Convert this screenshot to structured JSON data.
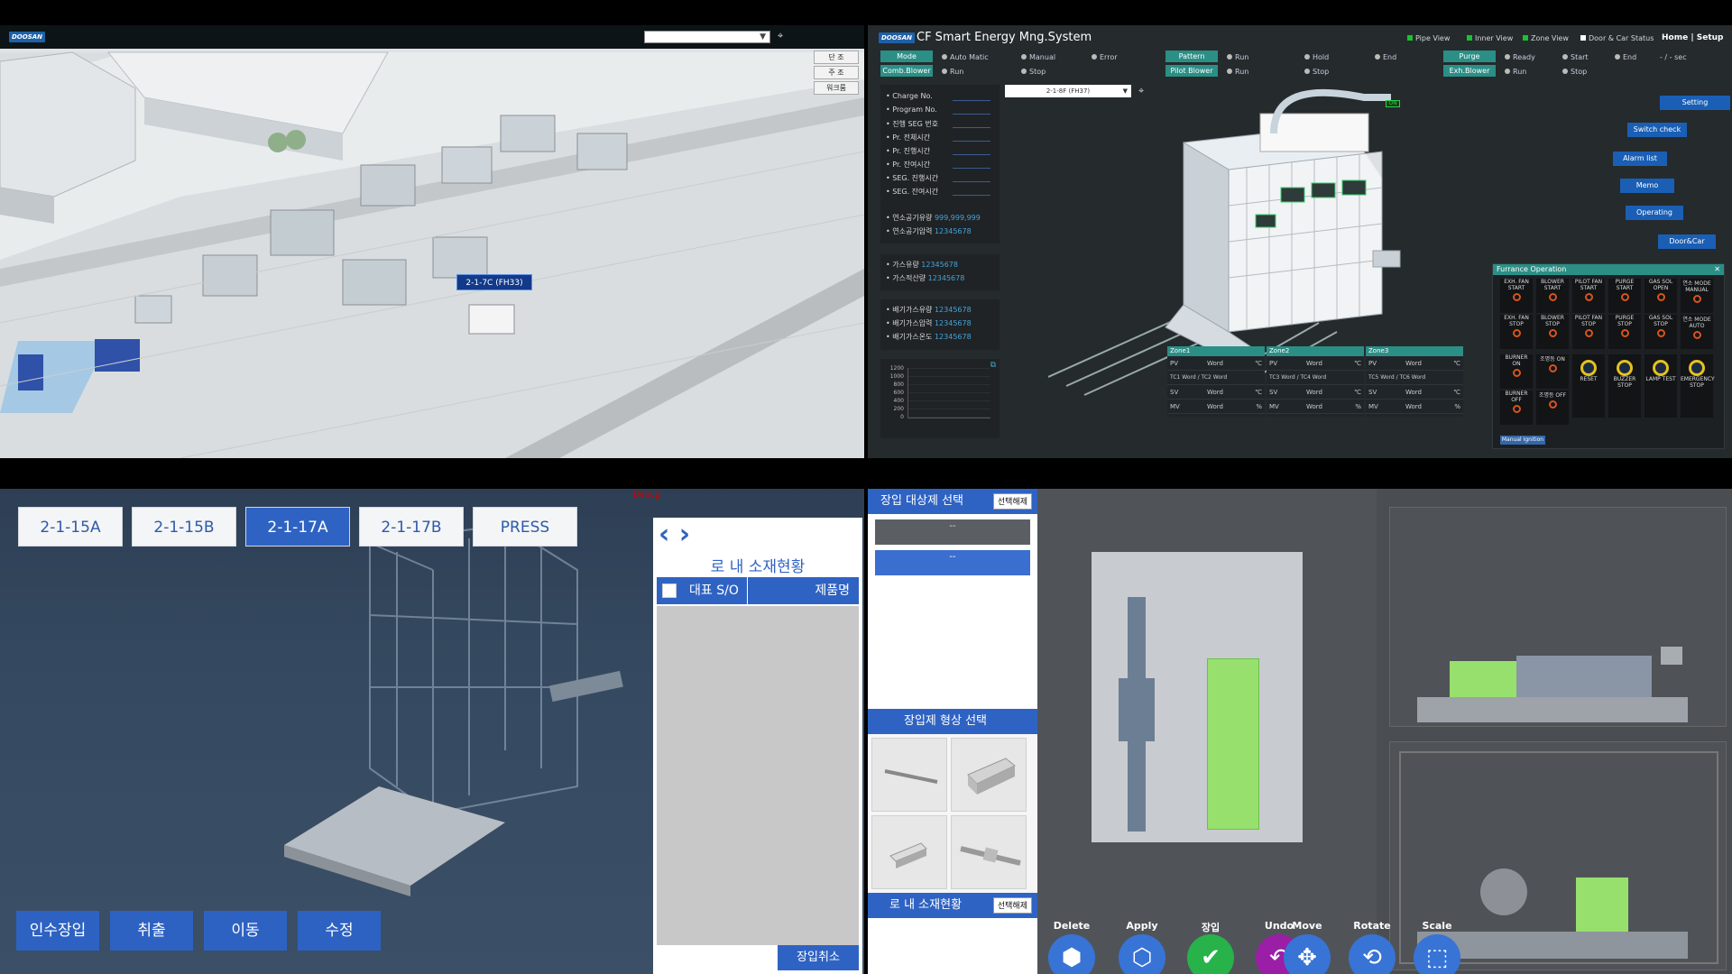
{
  "panel1": {
    "logo": "DOOSAN",
    "buttons": [
      "단 조",
      "주 조",
      "워크룸"
    ],
    "highlight_label": "2-1-7C (FH33)"
  },
  "panel2": {
    "logo": "DOOSAN",
    "title": "CF Smart Energy Mng.System",
    "legend": [
      "Pipe View",
      "Inner View",
      "Zone View",
      "Door & Car Status"
    ],
    "nav": "Home | Setup",
    "row1": {
      "mode": "Mode",
      "auto": "Auto Matic",
      "manual": "Manual",
      "error": "Error",
      "pattern": "Pattern",
      "run": "Run",
      "hold": "Hold",
      "end": "End",
      "purge": "Purge",
      "ready": "Ready",
      "start": "Start",
      "purge_end": "End",
      "sec": "- / - sec"
    },
    "row2": {
      "comb": "Comb.Blower",
      "run": "Run",
      "stop": "Stop",
      "pilot": "Pilot Blower",
      "prun": "Run",
      "pstop": "Stop",
      "exh": "Exh.Blower",
      "erun": "Run",
      "estop": "Stop"
    },
    "info": [
      "• Charge No.",
      "• Program No.",
      "• 진행 SEG 번호",
      "• Pr. 전체시간",
      "• Pr. 진행시간",
      "• Pr. 잔여시간",
      "• SEG. 진행시간",
      "• SEG. 잔여시간"
    ],
    "fuel": [
      {
        "label": "• 연소공기유량",
        "value": "999,999,999"
      },
      {
        "label": "• 연소공기압력",
        "value": "12345678"
      }
    ],
    "gas": [
      {
        "label": "• 가스유량",
        "value": "12345678"
      },
      {
        "label": "• 가스적산량",
        "value": "12345678"
      }
    ],
    "exhaust": [
      {
        "label": "• 배기가스유량",
        "value": "12345678"
      },
      {
        "label": "• 배기가스압력",
        "value": "12345678"
      },
      {
        "label": "• 배기가스온도",
        "value": "12345678"
      }
    ],
    "chart_ticks": [
      "1200",
      "1000",
      "800",
      "600",
      "400",
      "200",
      "0"
    ],
    "combo": "2-1-8F (FH37)",
    "on_badge": "ON",
    "side_buttons": [
      "Setting",
      "Switch check",
      "Alarm list",
      "Memo",
      "Operating",
      "Door&Car"
    ],
    "furnace_op": {
      "title": "Furrance Operation",
      "row1": [
        "EXH. FAN START",
        "BLOWER START",
        "PILOT FAN START",
        "PURGE START",
        "GAS SOL OPEN",
        "연소 MODE MANUAL"
      ],
      "row2": [
        "EXH. FAN STOP",
        "BLOWER STOP",
        "PILOT FAN STOP",
        "PURGE STOP",
        "GAS SOL STOP",
        "연소 MODE AUTO"
      ],
      "burner": [
        "BURNER ON",
        "조명등 ON",
        "BURNER OFF",
        "조명등 OFF"
      ],
      "big": [
        "RESET",
        "BUZZER STOP",
        "LAMP TEST",
        "EMERGENCY STOP"
      ],
      "manual": "Manual Ignition"
    },
    "zones": [
      {
        "name": "Zone1",
        "tc_a": "TC1",
        "tc_b": "TC2"
      },
      {
        "name": "Zone2",
        "tc_a": "TC3",
        "tc_b": "TC4"
      },
      {
        "name": "Zone3",
        "tc_a": "TC5",
        "tc_b": "TC6"
      }
    ],
    "zone_word": "Word",
    "zone_rows": [
      "PV",
      "SV",
      "MV"
    ],
    "deg": "℃",
    "pct": "%"
  },
  "panel3": {
    "tabs": [
      "2-1-15A",
      "2-1-15B",
      "2-1-17A",
      "2-1-17B",
      "PRESS"
    ],
    "actions": [
      "인수장입",
      "취출",
      "이동",
      "수정"
    ],
    "red_text": "Debug",
    "side_title": "로 내 소재현황",
    "col1": "대표 S/O",
    "col2": "제품명",
    "cancel": "장입취소"
  },
  "panel4": {
    "head1": "장입 대상제 선택",
    "pill": "선택해제",
    "gray_item": "--",
    "blue_item": "--",
    "head2": "장입제 형상 선택",
    "head3": "로 내 소재현황",
    "actions": [
      "Delete",
      "Apply",
      "장입",
      "Undo"
    ],
    "tools": [
      "Move",
      "Rotate",
      "Scale"
    ]
  }
}
